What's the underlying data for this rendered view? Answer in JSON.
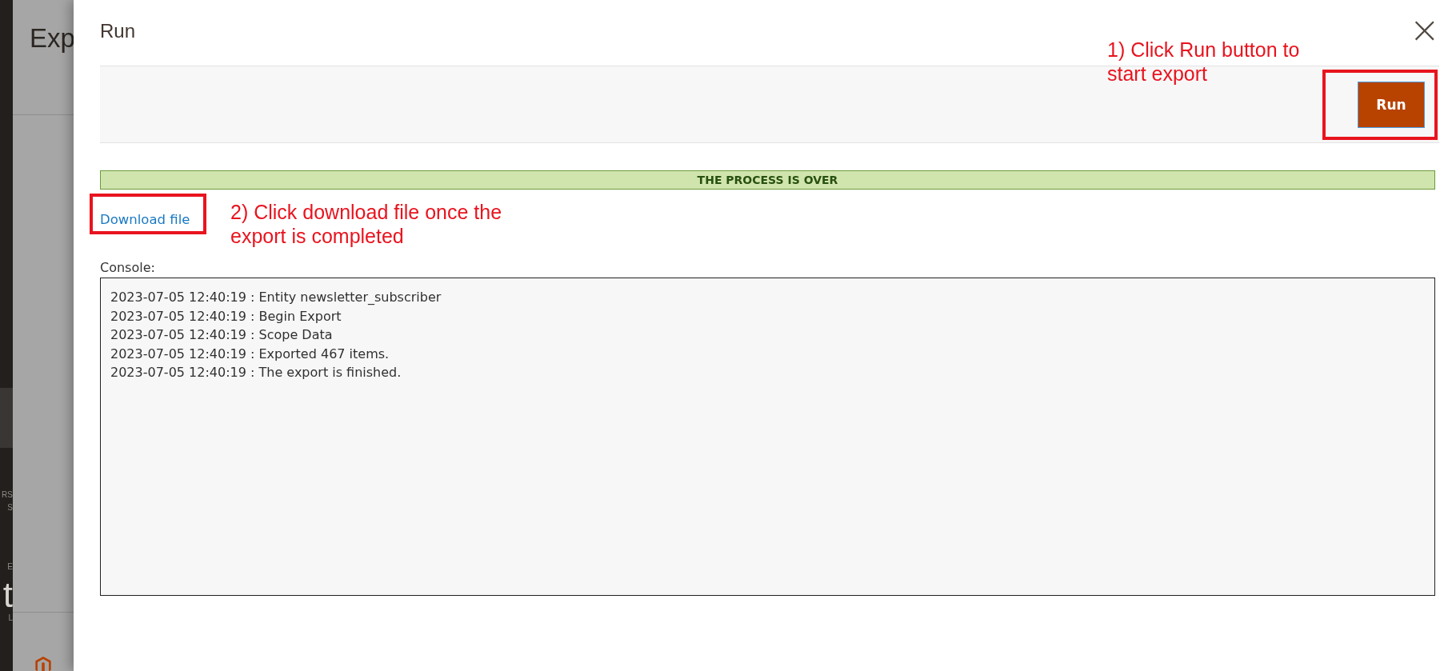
{
  "background_page": {
    "title": "Exp",
    "sidebar_fragments": [
      "RS",
      "S",
      "E",
      "t",
      "L"
    ]
  },
  "modal": {
    "title": "Run",
    "close_label": "×",
    "run_button": "Run",
    "status_banner": "THE PROCESS IS OVER",
    "download_link": "Download file",
    "console": {
      "label": "Console:",
      "lines": [
        "2023-07-05 12:40:19 : Entity newsletter_subscriber",
        "2023-07-05 12:40:19 : Begin Export",
        "2023-07-05 12:40:19 : Scope Data",
        "2023-07-05 12:40:19 : Exported 467 items.",
        "2023-07-05 12:40:19 : The export is finished."
      ]
    }
  },
  "annotations": [
    {
      "kind": "run",
      "text": "1) Click Run button to start export"
    },
    {
      "kind": "download",
      "text": "2) Click download file once the export is completed"
    }
  ]
}
